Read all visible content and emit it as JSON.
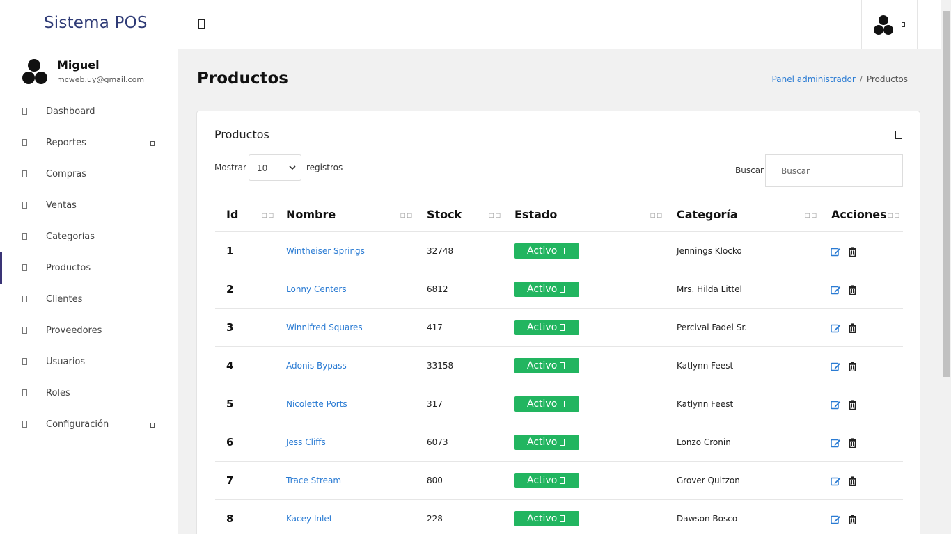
{
  "app": {
    "brand": "Sistema POS"
  },
  "user": {
    "name": "Miguel",
    "email": "mcweb.uy@gmail.com"
  },
  "sidebar": {
    "items": [
      {
        "label": "Dashboard",
        "icon": "circle-icon",
        "has_submenu": false,
        "active": false
      },
      {
        "label": "Reportes",
        "icon": "circle-icon",
        "has_submenu": true,
        "active": false
      },
      {
        "label": "Compras",
        "icon": "circle-icon",
        "has_submenu": false,
        "active": false
      },
      {
        "label": "Ventas",
        "icon": "circle-icon",
        "has_submenu": false,
        "active": false
      },
      {
        "label": "Categorías",
        "icon": "circle-icon",
        "has_submenu": false,
        "active": false
      },
      {
        "label": "Productos",
        "icon": "circle-icon",
        "has_submenu": false,
        "active": true
      },
      {
        "label": "Clientes",
        "icon": "circle-icon",
        "has_submenu": false,
        "active": false
      },
      {
        "label": "Proveedores",
        "icon": "circle-icon",
        "has_submenu": false,
        "active": false
      },
      {
        "label": "Usuarios",
        "icon": "circle-icon",
        "has_submenu": false,
        "active": false
      },
      {
        "label": "Roles",
        "icon": "circle-icon",
        "has_submenu": false,
        "active": false
      },
      {
        "label": "Configuración",
        "icon": "circle-icon",
        "has_submenu": true,
        "active": false
      }
    ]
  },
  "page": {
    "title": "Productos",
    "breadcrumb": {
      "home": "Panel administrador",
      "separator": "/",
      "current": "Productos"
    }
  },
  "card": {
    "title": "Productos"
  },
  "table_controls": {
    "show_label": "Mostrar",
    "page_size": "10",
    "records_label": "registros",
    "search_label": "Buscar",
    "search_placeholder": "Buscar"
  },
  "table": {
    "headers": [
      "Id",
      "Nombre",
      "Stock",
      "Estado",
      "Categoría",
      "Acciones"
    ],
    "rows": [
      {
        "id": "1",
        "name": "Wintheiser Springs",
        "stock": "32748",
        "status": "Activo",
        "category": "Jennings Klocko"
      },
      {
        "id": "2",
        "name": "Lonny Centers",
        "stock": "6812",
        "status": "Activo",
        "category": "Mrs. Hilda Littel"
      },
      {
        "id": "3",
        "name": "Winnifred Squares",
        "stock": "417",
        "status": "Activo",
        "category": "Percival Fadel Sr."
      },
      {
        "id": "4",
        "name": "Adonis Bypass",
        "stock": "33158",
        "status": "Activo",
        "category": "Katlynn Feest"
      },
      {
        "id": "5",
        "name": "Nicolette Ports",
        "stock": "317",
        "status": "Activo",
        "category": "Katlynn Feest"
      },
      {
        "id": "6",
        "name": "Jess Cliffs",
        "stock": "6073",
        "status": "Activo",
        "category": "Lonzo Cronin"
      },
      {
        "id": "7",
        "name": "Trace Stream",
        "stock": "800",
        "status": "Activo",
        "category": "Grover Quitzon"
      },
      {
        "id": "8",
        "name": "Kacey Inlet",
        "stock": "228",
        "status": "Activo",
        "category": "Dawson Bosco"
      }
    ]
  },
  "colors": {
    "brand": "#2f3b76",
    "link": "#2a7bd3",
    "status_active": "#22b560",
    "active_indicator": "#3a3476"
  }
}
